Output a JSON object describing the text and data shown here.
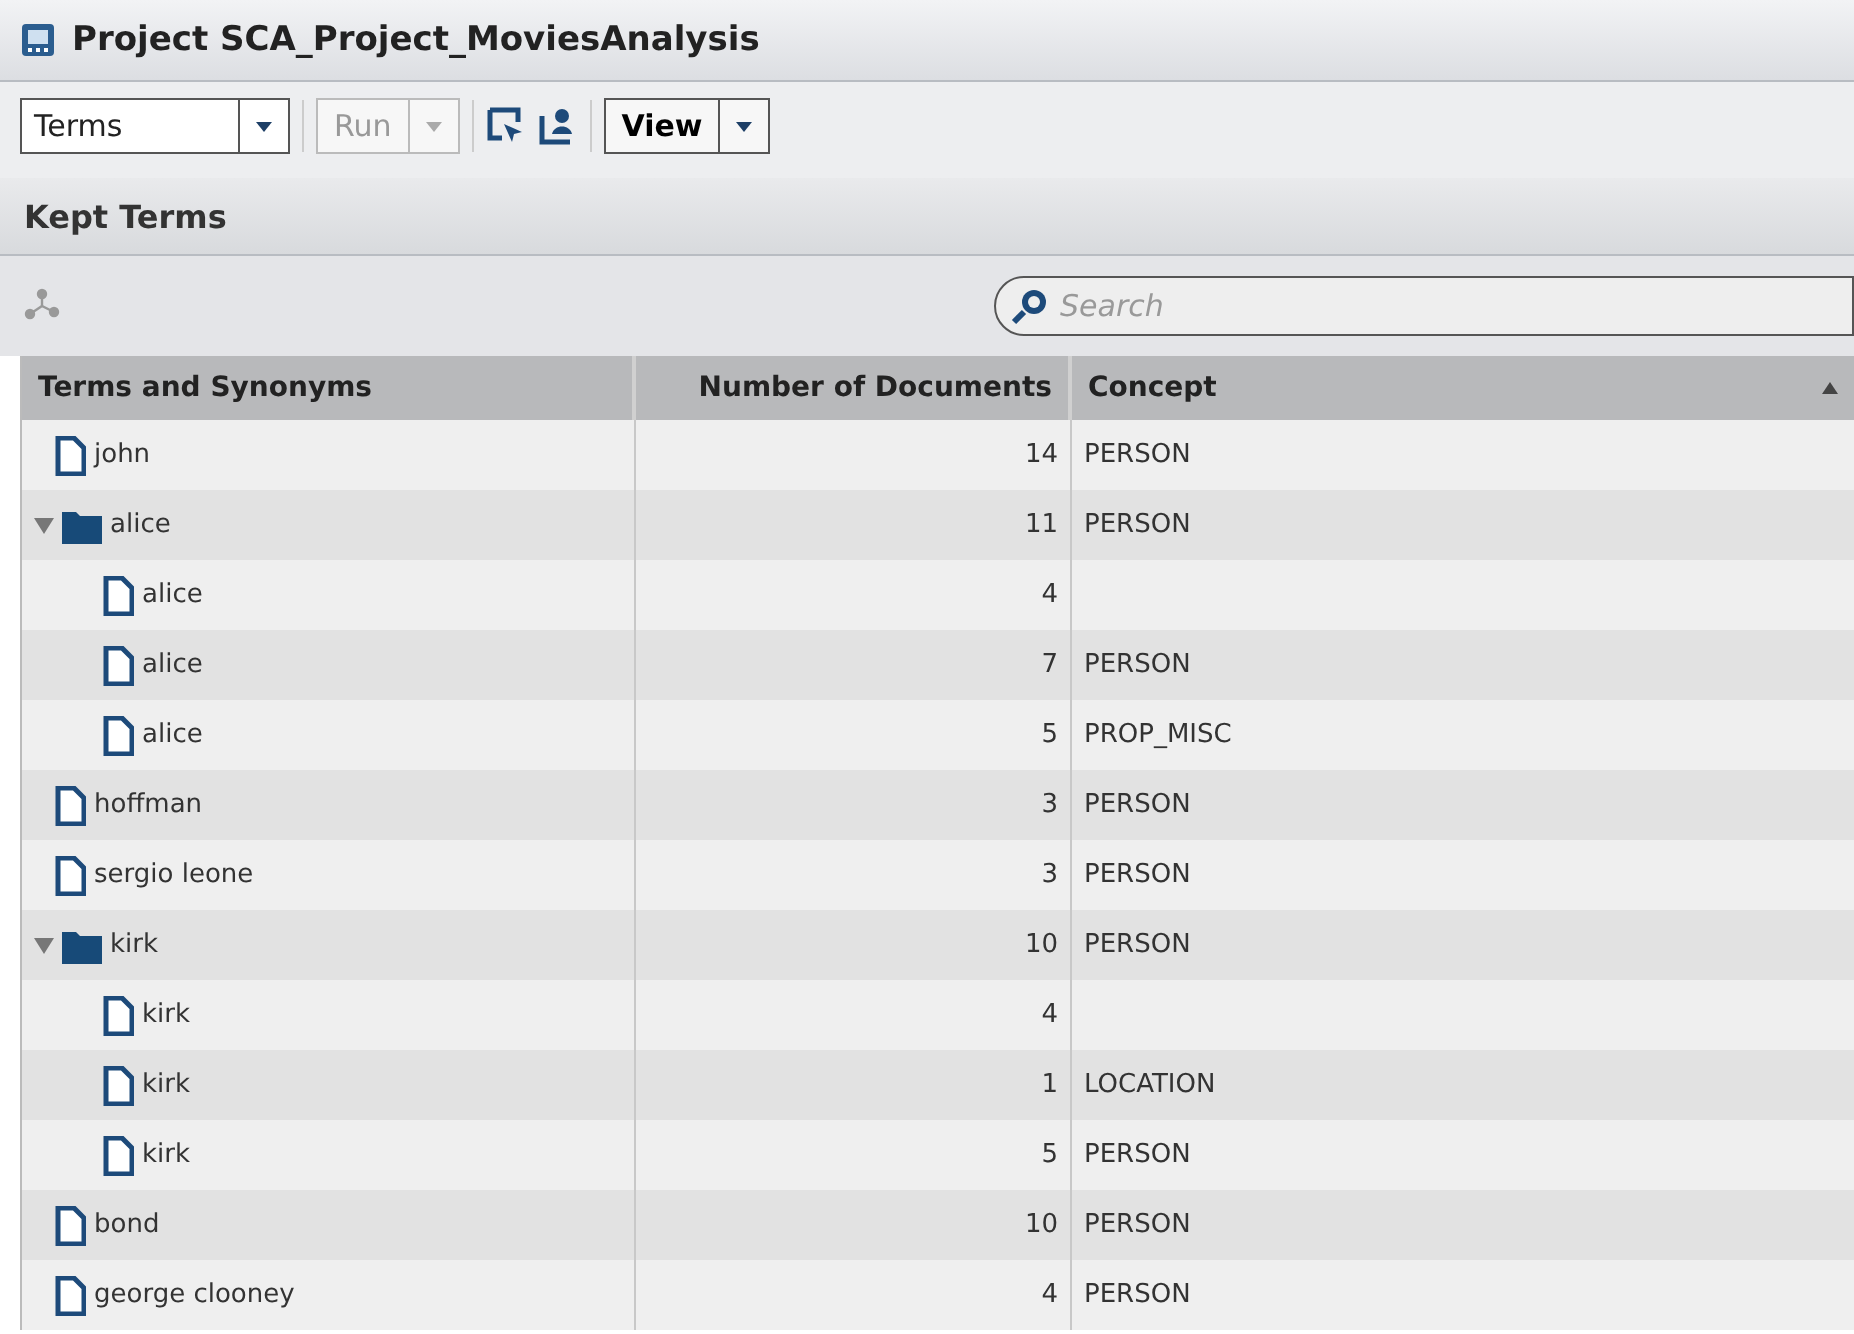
{
  "window": {
    "title": "Project SCA_Project_MoviesAnalysis"
  },
  "toolbar": {
    "view_select": {
      "value": "Terms"
    },
    "run_button": {
      "label": "Run",
      "disabled": true
    },
    "view_button": {
      "label": "View"
    }
  },
  "panel": {
    "title": "Kept Terms"
  },
  "search": {
    "placeholder": "Search"
  },
  "table": {
    "columns": [
      "Terms and Synonyms",
      "Number of Documents",
      "Concept"
    ],
    "rows": [
      {
        "kind": "term",
        "term": "john",
        "documents": "14",
        "concept": "PERSON"
      },
      {
        "kind": "folder",
        "term": "alice",
        "documents": "11",
        "concept": "PERSON",
        "expanded": true,
        "children": [
          {
            "kind": "term",
            "term": "alice",
            "documents": "4"
          },
          {
            "kind": "term",
            "term": "alice",
            "documents": "7",
            "concept": "PERSON"
          },
          {
            "kind": "term",
            "term": "alice",
            "documents": "5",
            "concept": "PROP_MISC"
          }
        ]
      },
      {
        "kind": "term",
        "term": "hoffman",
        "documents": "3",
        "concept": "PERSON"
      },
      {
        "kind": "term",
        "term": "sergio leone",
        "documents": "3",
        "concept": "PERSON"
      },
      {
        "kind": "folder",
        "term": "kirk",
        "documents": "10",
        "concept": "PERSON",
        "expanded": true,
        "children": [
          {
            "kind": "term",
            "term": "kirk",
            "documents": "4"
          },
          {
            "kind": "term",
            "term": "kirk",
            "documents": "1",
            "concept": "LOCATION"
          },
          {
            "kind": "term",
            "term": "kirk",
            "documents": "5",
            "concept": "PERSON"
          }
        ]
      },
      {
        "kind": "term",
        "term": "bond",
        "documents": "10",
        "concept": "PERSON"
      },
      {
        "kind": "term",
        "term": "george clooney",
        "documents": "4",
        "concept": "PERSON"
      }
    ]
  }
}
